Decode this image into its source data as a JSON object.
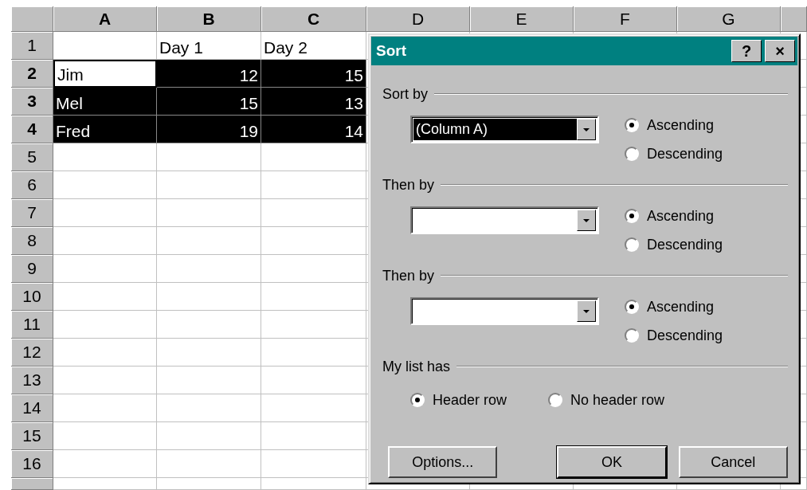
{
  "sheet": {
    "columns": [
      {
        "label": "A",
        "selected": true
      },
      {
        "label": "B",
        "selected": true
      },
      {
        "label": "C",
        "selected": true
      },
      {
        "label": "D",
        "selected": false
      },
      {
        "label": "E",
        "selected": false
      },
      {
        "label": "F",
        "selected": false
      },
      {
        "label": "G",
        "selected": false
      }
    ],
    "rows": [
      {
        "header": "1",
        "selected": false,
        "cells": [
          {
            "kind": "empty"
          },
          {
            "text": "Day 1",
            "kind": "text",
            "selected": false,
            "active": false
          },
          {
            "text": "Day 2",
            "kind": "text",
            "selected": false,
            "active": false
          }
        ]
      },
      {
        "header": "2",
        "selected": true,
        "cells": [
          {
            "text": "Jim",
            "kind": "text",
            "selected": true,
            "active": true
          },
          {
            "text": "12",
            "kind": "number",
            "selected": true,
            "active": false
          },
          {
            "text": "15",
            "kind": "number",
            "selected": true,
            "active": false
          }
        ]
      },
      {
        "header": "3",
        "selected": true,
        "cells": [
          {
            "text": "Mel",
            "kind": "text",
            "selected": true,
            "active": false
          },
          {
            "text": "15",
            "kind": "number",
            "selected": true,
            "active": false
          },
          {
            "text": "13",
            "kind": "number",
            "selected": true,
            "active": false
          }
        ]
      },
      {
        "header": "4",
        "selected": true,
        "cells": [
          {
            "text": "Fred",
            "kind": "text",
            "selected": true,
            "active": false
          },
          {
            "text": "19",
            "kind": "number",
            "selected": true,
            "active": false
          },
          {
            "text": "14",
            "kind": "number",
            "selected": true,
            "active": false
          }
        ]
      },
      {
        "header": "5",
        "selected": false
      },
      {
        "header": "6",
        "selected": false
      },
      {
        "header": "7",
        "selected": false
      },
      {
        "header": "8",
        "selected": false
      },
      {
        "header": "9",
        "selected": false
      },
      {
        "header": "10",
        "selected": false
      },
      {
        "header": "11",
        "selected": false
      },
      {
        "header": "12",
        "selected": false
      },
      {
        "header": "13",
        "selected": false
      },
      {
        "header": "14",
        "selected": false
      },
      {
        "header": "15",
        "selected": false
      },
      {
        "header": "16",
        "selected": false
      }
    ]
  },
  "dialog": {
    "title": "Sort",
    "help": "?",
    "close": "×",
    "sections": [
      {
        "label": "Sort by",
        "combo": {
          "value": "(Column A)",
          "highlighted": true
        },
        "options": [
          {
            "label": "Ascending",
            "selected": true
          },
          {
            "label": "Descending",
            "selected": false
          }
        ]
      },
      {
        "label": "Then by",
        "combo": {
          "highlighted": false
        },
        "options": [
          {
            "label": "Ascending",
            "selected": true
          },
          {
            "label": "Descending",
            "selected": false
          }
        ]
      },
      {
        "label": "Then by",
        "combo": {
          "highlighted": false
        },
        "options": [
          {
            "label": "Ascending",
            "selected": true
          },
          {
            "label": "Descending",
            "selected": false
          }
        ]
      }
    ],
    "header_group": {
      "label": "My list has",
      "options": [
        {
          "label": "Header row",
          "selected": true
        },
        {
          "label": "No header row",
          "selected": false
        }
      ]
    },
    "buttons": [
      {
        "label": "Options...",
        "default": false
      },
      {
        "label": "OK",
        "default": true
      },
      {
        "label": "Cancel",
        "default": false
      }
    ]
  }
}
